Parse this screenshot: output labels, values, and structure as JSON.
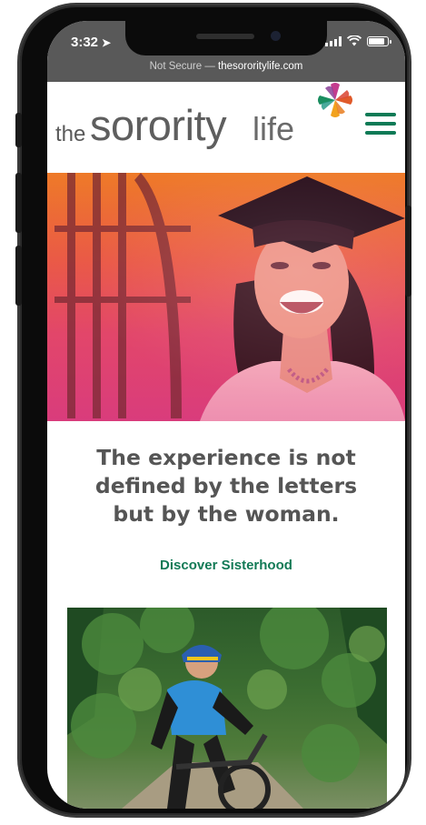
{
  "status": {
    "time": "3:32"
  },
  "browser": {
    "security_label": "Not Secure",
    "separator": " — ",
    "domain": "thesororitylife.com"
  },
  "logo": {
    "the": "the",
    "sorority": "sorority",
    "life": "life"
  },
  "hero": {
    "quote": "The experience is not defined by the letters but by the woman."
  },
  "cta": {
    "label": "Discover Sisterhood"
  },
  "colors": {
    "brand_green": "#127a56",
    "hero_top": "#ee7a28",
    "hero_bottom": "#d93c7c",
    "status_gray": "#595959"
  }
}
